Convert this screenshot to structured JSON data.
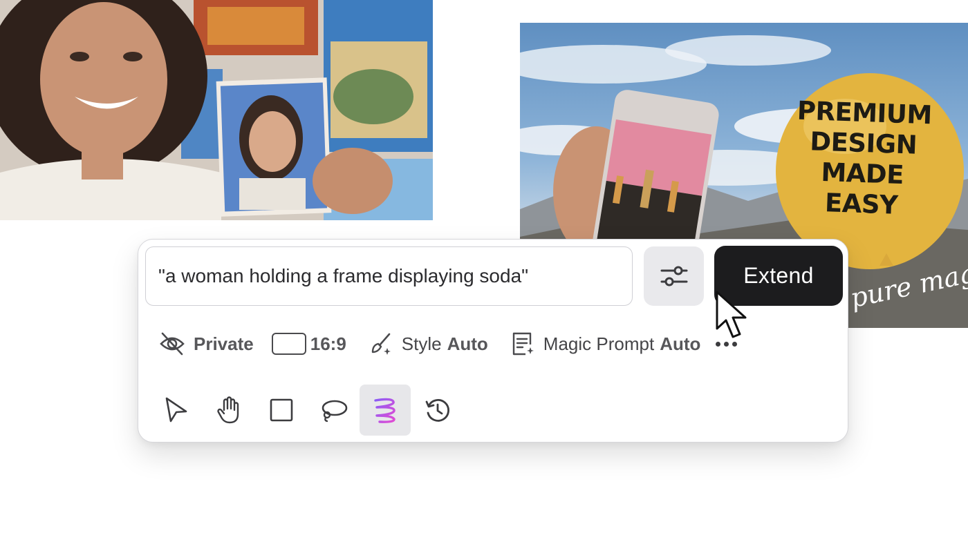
{
  "prompt": {
    "value": "\"a woman holding a frame displaying soda\""
  },
  "actions": {
    "settings_icon": "sliders-icon",
    "extend_label": "Extend"
  },
  "options": {
    "private_label": "Private",
    "aspect_ratio": "16:9",
    "style_label": "Style",
    "style_value": "Auto",
    "magic_prompt_label": "Magic Prompt",
    "magic_prompt_value": "Auto"
  },
  "tools": [
    {
      "name": "select",
      "icon": "pointer-icon"
    },
    {
      "name": "pan",
      "icon": "hand-icon"
    },
    {
      "name": "rectangle",
      "icon": "square-icon"
    },
    {
      "name": "lasso",
      "icon": "lasso-icon"
    },
    {
      "name": "magic-brush",
      "icon": "magic-scribble-icon",
      "active": true
    },
    {
      "name": "history",
      "icon": "history-icon"
    }
  ],
  "canvas_images": {
    "right_image_text": {
      "balloon_lines": [
        "PREMIUM",
        "DESIGN",
        "MADE",
        "EASY"
      ],
      "script": "pure magic"
    }
  },
  "colors": {
    "extend_button": "#1c1c1e",
    "active_tool_bg": "#e7e7ea",
    "accent_gradient": [
      "#8a5cf6",
      "#e24bd3"
    ]
  }
}
